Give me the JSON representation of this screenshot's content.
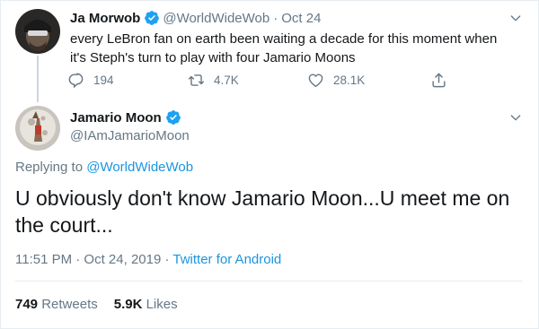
{
  "parent_tweet": {
    "display_name": "Ja Morwob",
    "handle": "@WorldWideWob",
    "separator": "·",
    "time": "Oct 24",
    "text": "every LeBron fan on earth been waiting a decade for this moment when it's Steph's turn to play with four Jamario Moons",
    "replies": "194",
    "retweets": "4.7K",
    "likes": "28.1K",
    "icons": [
      "reply-icon",
      "retweet-icon",
      "like-icon",
      "share-icon"
    ]
  },
  "reply_tweet": {
    "display_name": "Jamario Moon",
    "handle": "@IAmJamarioMoon",
    "replying_prefix": "Replying to",
    "replying_handle": "@WorldWideWob",
    "text": "U obviously don't know Jamario Moon...U meet me on the court...",
    "time": "11:51 PM · Oct 24, 2019",
    "meta_separator": " · ",
    "source": "Twitter for Android",
    "retweets_count": "749",
    "retweets_label": "Retweets",
    "likes_count": "5.9K",
    "likes_label": "Likes"
  },
  "colors": {
    "accent": "#1b95e0",
    "secondary_text": "#657786",
    "primary_text": "#14171a",
    "verified": "#1da1f2",
    "border": "#e6ecf0"
  }
}
